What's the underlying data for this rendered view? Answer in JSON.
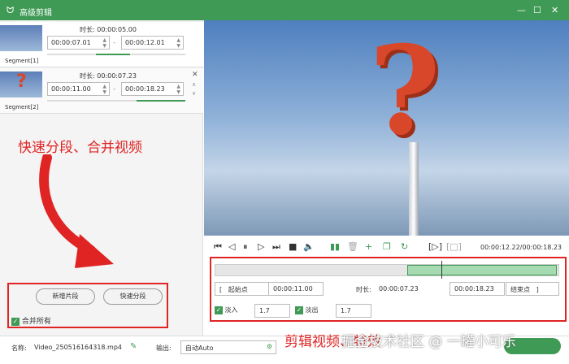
{
  "window": {
    "title": "高级剪辑"
  },
  "segments": [
    {
      "label": "Segment[1]",
      "duration_label": "时长:",
      "duration": "00:00:05.00",
      "start": "00:00:07.01",
      "end": "00:00:12.01"
    },
    {
      "label": "Segment[2]",
      "duration_label": "时长:",
      "duration": "00:00:07.23",
      "start": "00:00:11.00",
      "end": "00:00:18.23"
    }
  ],
  "left_buttons": {
    "add_segment": "新增片段",
    "quick_split": "快速分段",
    "merge_all": "合并所有"
  },
  "annotations": {
    "left": "快速分段、合并视频",
    "bottom": "剪辑视频、特效",
    "watermark": "掘金技术社区 @ 一罐小可乐"
  },
  "player": {
    "time": "00:00:12.22/00:00:18.23"
  },
  "trim": {
    "start_btn": "起始点",
    "start": "00:00:11.00",
    "duration_label": "时长:",
    "duration": "00:00:07.23",
    "end": "00:00:18.23",
    "end_btn": "结束点",
    "fade_in_label": "淡入",
    "fade_in": "1.7",
    "fade_out_label": "淡出",
    "fade_out": "1.7"
  },
  "bottom": {
    "name_label": "名称:",
    "name": "Video_250516164318.mp4",
    "output_label": "输出:",
    "output": "自动Auto"
  },
  "colors": {
    "accent": "#3f9a55",
    "annotation": "#e02424"
  }
}
